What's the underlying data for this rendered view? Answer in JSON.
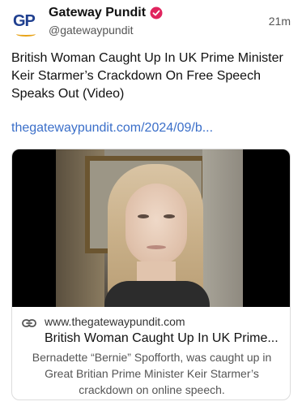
{
  "post": {
    "display_name": "Gateway Pundit",
    "handle": "@gatewaypundit",
    "time": "21m",
    "avatar_text": "GP",
    "text": "British Woman Caught Up In UK Prime Minister Keir Starmer’s Crackdown On Free Speech Speaks Out (Video)",
    "link_text": "thegatewaypundit.com/2024/09/b..."
  },
  "card": {
    "domain": "www.thegatewaypundit.com",
    "title": "British Woman Caught Up In UK Prime...",
    "description": "Bernadette “Bernie” Spofforth, was caught up in Great Britian Prime Minister Keir Starmer’s crackdown on online speech."
  },
  "icons": {
    "verified": "verified-badge-icon",
    "link": "link-icon"
  },
  "colors": {
    "accent_link": "#3b6fc9",
    "verified": "#e0245e",
    "avatar_blue": "#1f3f8f",
    "avatar_gold": "#e8a317"
  }
}
